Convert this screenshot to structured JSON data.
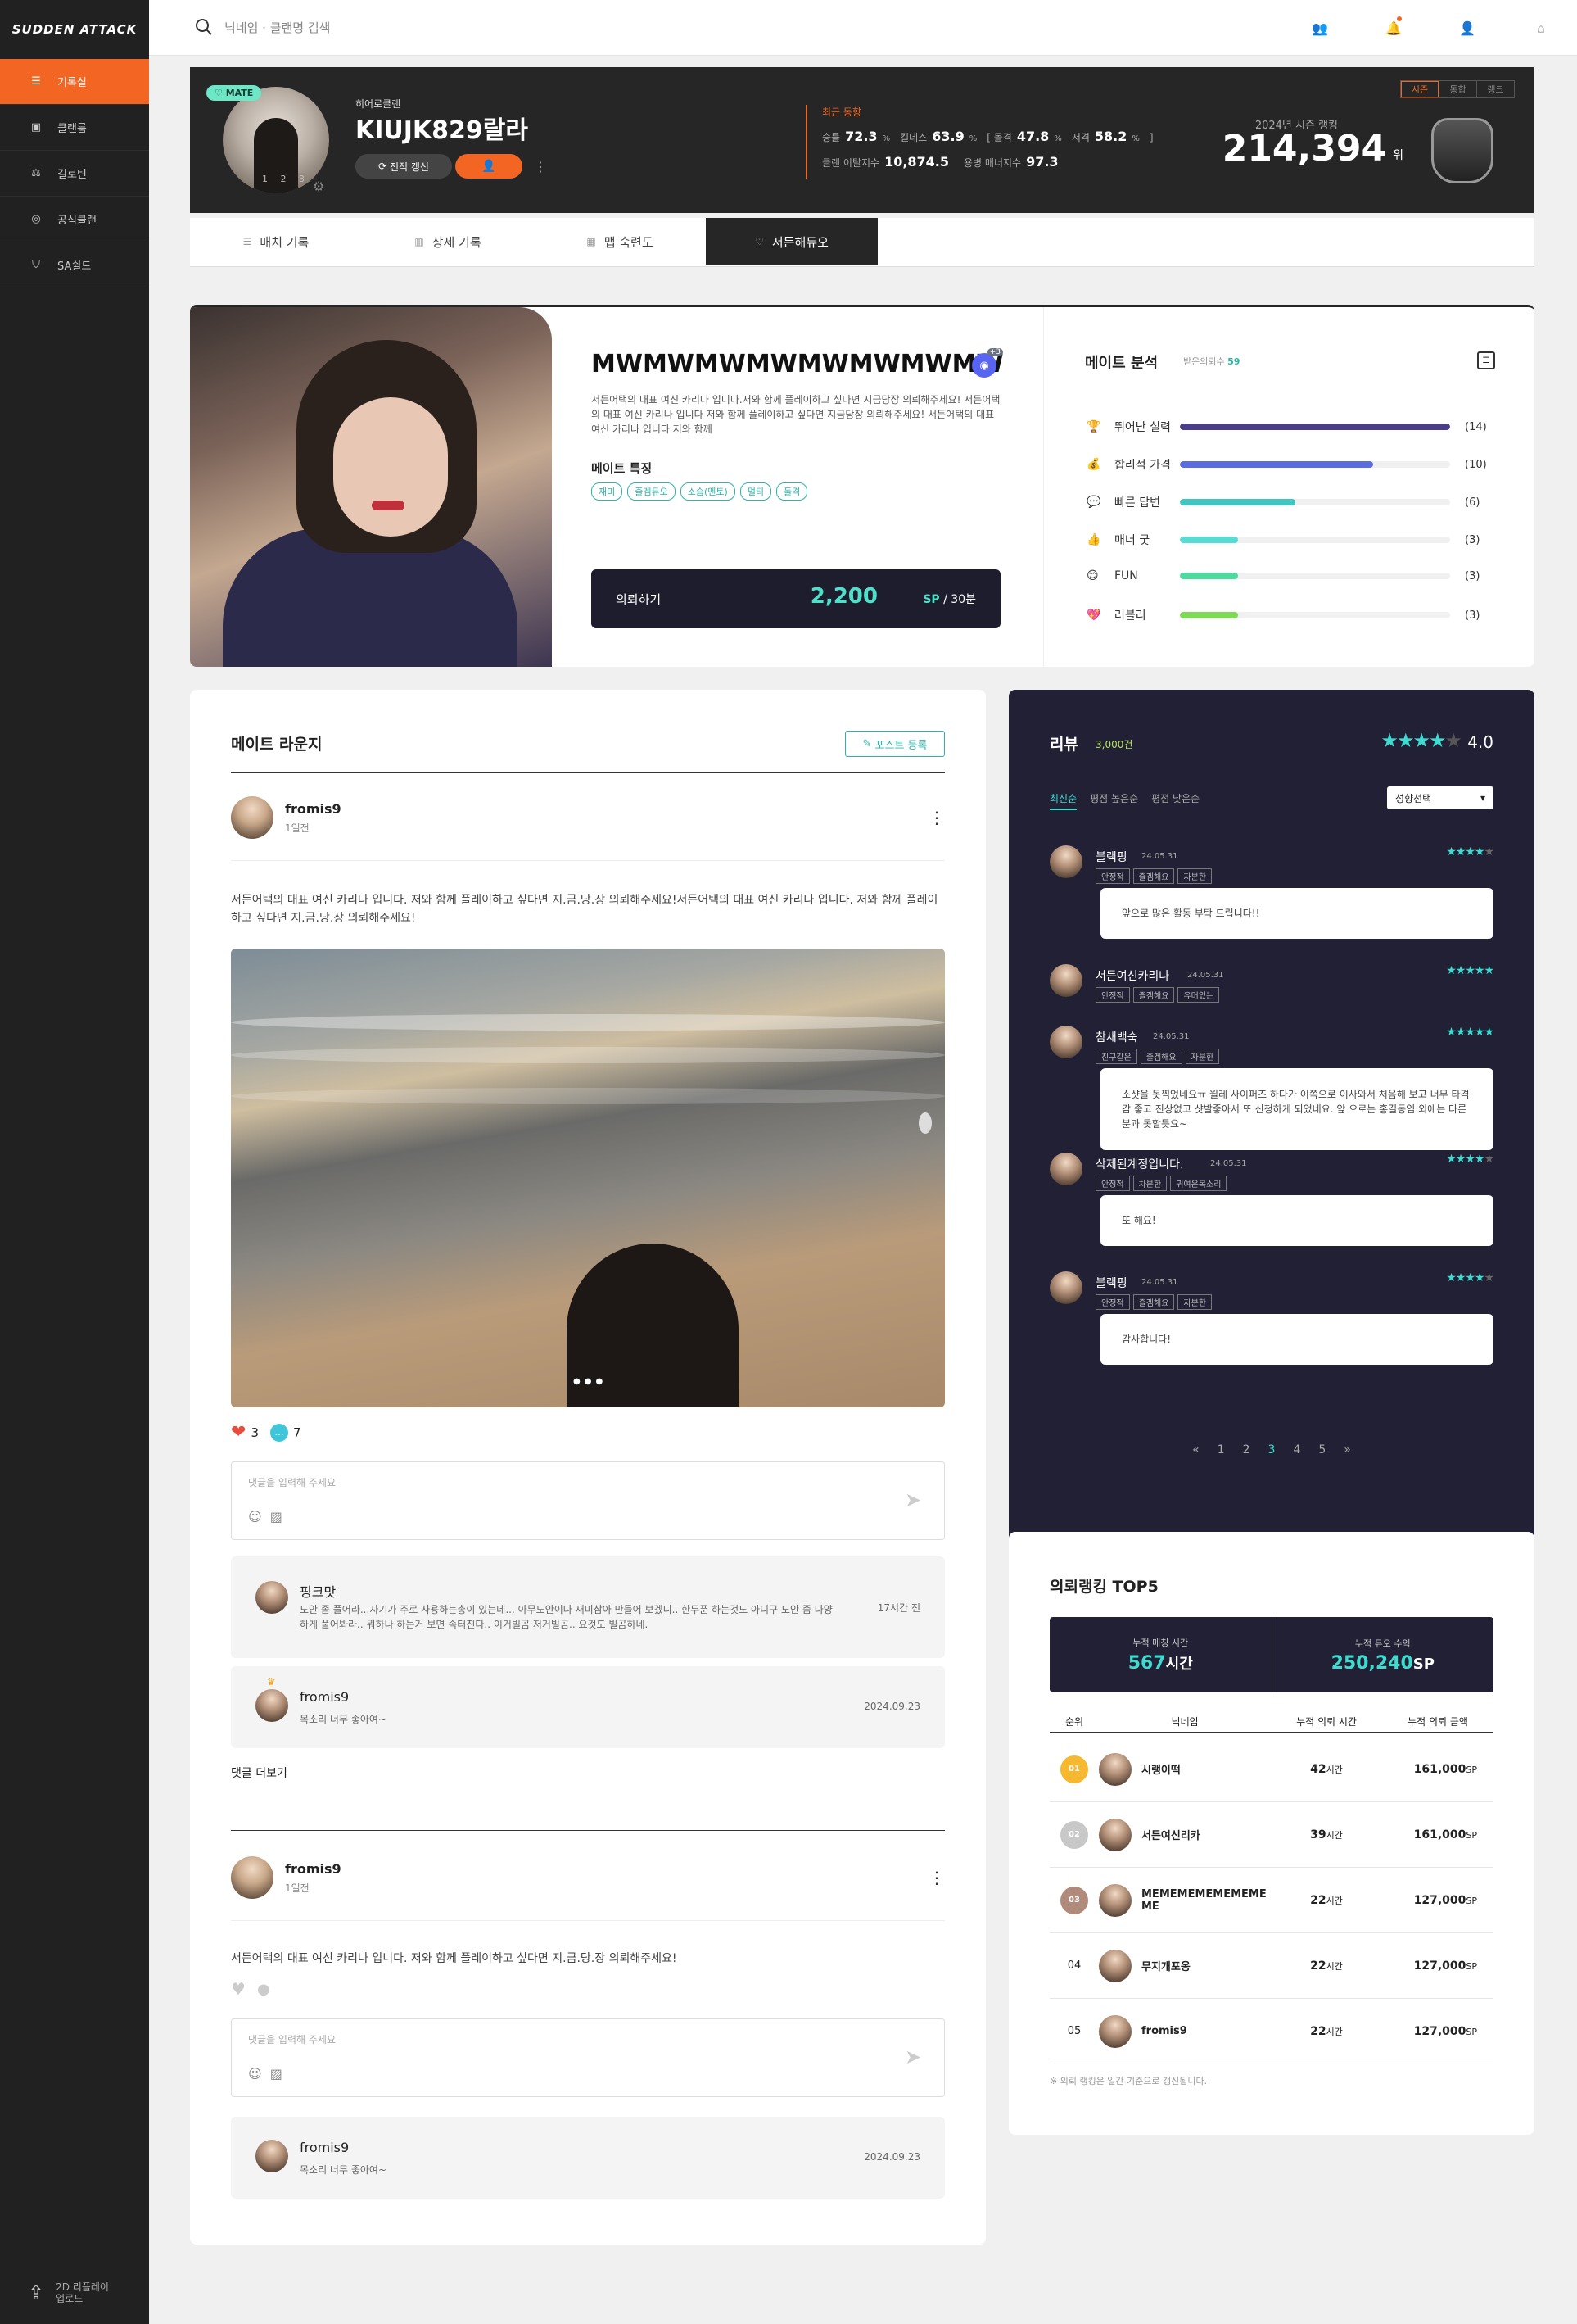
{
  "brand": {
    "logo_text": "SUDDEN ATTACK"
  },
  "sidebar": {
    "items": [
      {
        "label": "기록실",
        "icon": "list-icon",
        "active": true
      },
      {
        "label": "클랜룸",
        "icon": "clan-room-icon"
      },
      {
        "label": "길로틴",
        "icon": "guillotine-icon"
      },
      {
        "label": "공식클랜",
        "icon": "official-clan-icon"
      },
      {
        "label": "SA쉴드",
        "icon": "shield-icon"
      }
    ],
    "upload": {
      "line1": "2D 리플레이",
      "line2": "업로드"
    }
  },
  "topbar": {
    "search_placeholder": "닉네임 · 클랜명 검색"
  },
  "profile": {
    "badge": "MATE",
    "pager": "1 2 3",
    "clan": "히어로클랜",
    "nickname": "KIUJK829랄라",
    "refresh_label": "전적 갱신",
    "recent_label": "최근 동향",
    "stats": {
      "win_label": "승률",
      "win": "72.3",
      "kd_label": "킬데스",
      "kd": "63.9",
      "hs_label": "돌격",
      "hs": "47.8",
      "snipe_label": "저격",
      "snipe": "58.2",
      "leave_label": "클랜 이탈지수",
      "leave": "10,874.5",
      "manner_label": "용병 매너지수",
      "manner": "97.3",
      "unit": "%"
    },
    "rank_tabs": [
      "시즌",
      "통합",
      "랭크"
    ],
    "season_label": "2024년 시즌 랭킹",
    "season_rank": "214,394",
    "season_unit": "위"
  },
  "subtabs": [
    {
      "label": "매치 기록",
      "active": false
    },
    {
      "label": "상세 기록",
      "active": false
    },
    {
      "label": "맵 숙련도",
      "active": false
    },
    {
      "label": "서든해듀오",
      "active": true
    }
  ],
  "mate": {
    "name": "MWMWMWMWMWMWMWMW",
    "discord_badge": "+3",
    "description": "서든어택의 대표 여신 카리나 입니다.저와 함께 플레이하고 싶다면 지금당장 의뢰해주세요! 서든어택의 대표 여신 카리나 입니다 저와 함께 플레이하고 싶다면 지금당장 의뢰해주세요! 서든어택의 대표 여신 카리나 입니다 저와 함께",
    "feature_title": "메이트 특징",
    "tags": [
      "재미",
      "즐겜듀오",
      "소슴(멘토)",
      "멀티",
      "돌격"
    ],
    "request_label": "의뢰하기",
    "price": "2,200",
    "price_unit": "SP",
    "price_per": "30분"
  },
  "analysis": {
    "title": "메이트 분석",
    "sub_label": "받은의뢰수",
    "sub_value": "59",
    "items": [
      {
        "label": "뛰어난 실력",
        "count": "14",
        "value": 14,
        "color": "#4a3e8a",
        "emoji": "🏆"
      },
      {
        "label": "합리적 가격",
        "count": "10",
        "value": 10,
        "color": "#5b6ee0",
        "emoji": "💰"
      },
      {
        "label": "빠른 답변",
        "count": "6",
        "value": 6,
        "color": "#3fc6c0",
        "emoji": "💬"
      },
      {
        "label": "매너 굿",
        "count": "3",
        "value": 3,
        "color": "#57dbd2",
        "emoji": "👍"
      },
      {
        "label": "FUN",
        "count": "3",
        "value": 3,
        "color": "#4ed99e",
        "emoji": "😊"
      },
      {
        "label": "러블리",
        "count": "3",
        "value": 3,
        "color": "#7ed957",
        "emoji": "💖"
      }
    ]
  },
  "lounge": {
    "title": "메이트 라운지",
    "post_button": "포스트 등록",
    "comment_placeholder": "댓글을 입력해 주세요",
    "more_comments": "댓글 더보기",
    "posts": [
      {
        "author": "fromis9",
        "time": "1일전",
        "text": "서든어택의 대표 여신 카리나 입니다. 저와 함께 플레이하고 싶다면 지.금.당.장 의뢰해주세요!서든어택의 대표 여신 카리나 입니다. 저와 함께 플레이하고 싶다면 지.금.당.장 의뢰해주세요!",
        "likes": "3",
        "comments": "7"
      },
      {
        "author": "fromis9",
        "time": "1일전",
        "text": "서든어택의 대표 여신 카리나 입니다. 저와 함께 플레이하고 싶다면 지.금.당.장 의뢰해주세요!"
      }
    ],
    "comment1": {
      "author": "핑크맛",
      "text": "도안 좀 풀어라...자기가 주로 사용하는총이 있는데... 아무도안이나 재미삼아 만들어 보겠니.. 한두푼 하는것도 아니구 도안 좀 다양하게 풀어봐라.. 뭐하나 하는거 보면 속터진다.. 이거빌곰 저거빌곰.. 요것도 빌곰하네.",
      "time": "17시간 전"
    },
    "comment2": {
      "author": "fromis9",
      "text": "목소리 너무 좋아여~",
      "time": "2024.09.23"
    },
    "comment3": {
      "author": "fromis9",
      "text": "목소리 너무 좋아여~",
      "time": "2024.09.23"
    }
  },
  "reviews": {
    "title": "리뷰",
    "count": "3,000건",
    "score": "4.0",
    "tabs": [
      "최신순",
      "평점 높은순",
      "평점 낮은순"
    ],
    "select": "성향선택",
    "items": [
      {
        "name": "블랙핑",
        "date": "24.05.31",
        "stars": 4,
        "tags": [
          "안정적",
          "즐겜해요",
          "자분한"
        ],
        "text": "앞으로 많은 활동 부탁 드립니다!!"
      },
      {
        "name": "서든여신카리나",
        "date": "24.05.31",
        "stars": 5,
        "tags": [
          "안정적",
          "즐겜해요",
          "유머있는"
        ],
        "text": ""
      },
      {
        "name": "참새백숙",
        "date": "24.05.31",
        "stars": 5,
        "tags": [
          "친구같은",
          "즐겜해요",
          "자분한"
        ],
        "text": "소샷을 못찍었네요ㅠ 월레 사이퍼즈 하다가 이쪽으로 이사와서 처음해 보고 너무 타격감 좋고 진상없고 샷발좋아서 또 신청하게 되었네요. 앞 으로는 홍길동임 외에는 다른 분과 못할듯요~"
      },
      {
        "name": "삭제된계정입니다.",
        "date": "24.05.31",
        "stars": 4,
        "tags": [
          "안정적",
          "차분한",
          "귀여운목소리"
        ],
        "text": "또 해요!"
      },
      {
        "name": "블랙핑",
        "date": "24.05.31",
        "stars": 4,
        "tags": [
          "안정적",
          "즐겜해요",
          "자분한"
        ],
        "text": "감사합니다!"
      }
    ],
    "pagination": [
      "«",
      "1",
      "2",
      "3",
      "4",
      "5",
      "»"
    ],
    "current_page": "3"
  },
  "top5": {
    "title": "의뢰랭킹 TOP5",
    "sum1_label": "누적 매칭 시간",
    "sum1_value": "567",
    "sum1_unit": "시간",
    "sum2_label": "누적 듀오 수익",
    "sum2_value": "250,240",
    "sum2_unit": "SP",
    "headers": [
      "순위",
      "닉네임",
      "누적 의뢰 시간",
      "누적 의뢰 금액"
    ],
    "rows": [
      {
        "rank": "01",
        "name": "시랭이떡",
        "hours": "42",
        "amount": "161,000",
        "medal": "#f5b82e"
      },
      {
        "rank": "02",
        "name": "서든여신리카",
        "hours": "39",
        "amount": "161,000",
        "medal": "#c8c8c8"
      },
      {
        "rank": "03",
        "name": "MEMEMEMEMEMEMEME",
        "hours": "22",
        "amount": "127,000",
        "medal": "#b08a7a"
      },
      {
        "rank": "04",
        "name": "무지개포옹",
        "hours": "22",
        "amount": "127,000",
        "medal": ""
      },
      {
        "rank": "05",
        "name": "fromis9",
        "hours": "22",
        "amount": "127,000",
        "medal": ""
      }
    ],
    "hour_unit": "시간",
    "amount_unit": "SP",
    "note": "※ 의뢰 랭킹은 일간 기준으로 갱신됩니다."
  }
}
